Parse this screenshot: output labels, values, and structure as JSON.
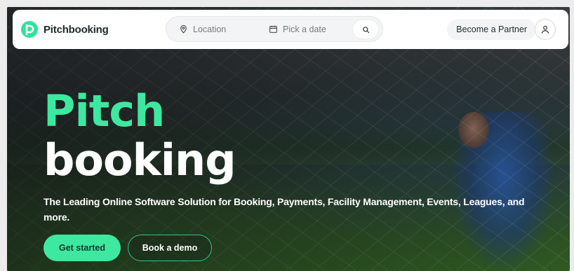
{
  "brand": {
    "name": "Pitchbooking",
    "accent": "#3ee8a0",
    "logo_icon": "pitchbooking-logo-icon"
  },
  "search": {
    "location_placeholder": "Location",
    "location_icon": "map-pin-icon",
    "date_placeholder": "Pick a date",
    "date_icon": "calendar-icon",
    "submit_icon": "search-icon"
  },
  "nav": {
    "partner_label": "Become a Partner",
    "user_icon": "user-icon"
  },
  "hero": {
    "title_line1": "Pitch",
    "title_line2": "booking",
    "subtitle": "The Leading Online Software Solution for Booking, Payments, Facility Management, Events, Leagues, and more.",
    "primary_cta": "Get started",
    "secondary_cta": "Book a demo"
  }
}
